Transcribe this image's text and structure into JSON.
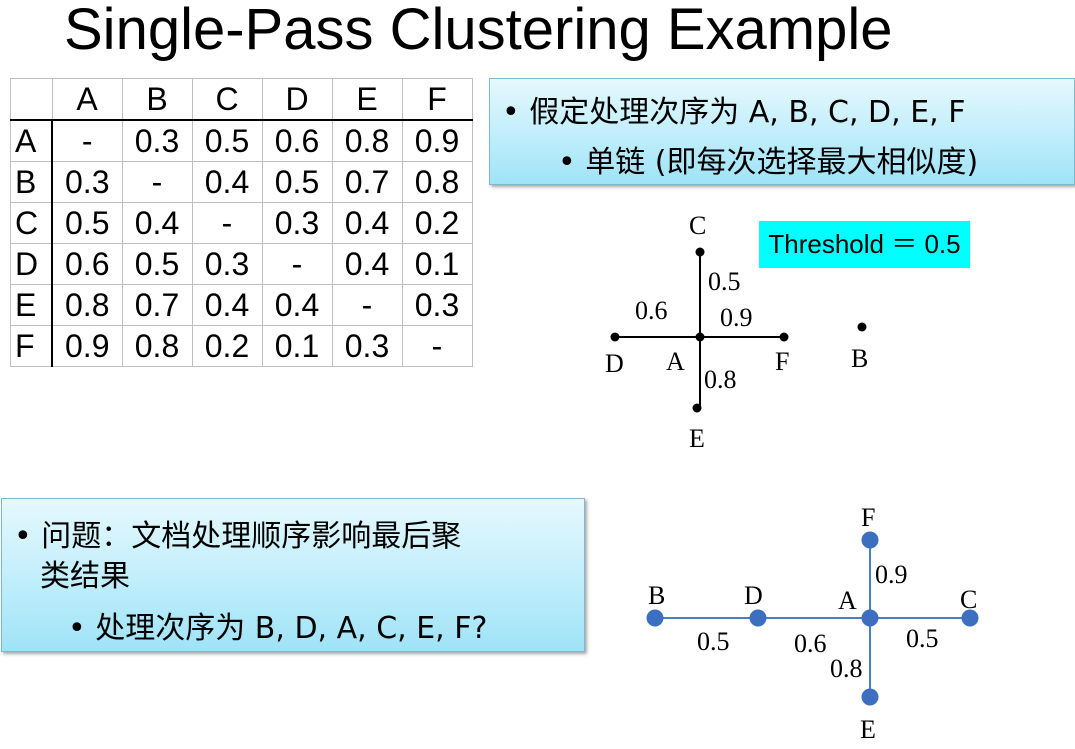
{
  "title": "Single-Pass Clustering Example",
  "matrix": {
    "columns": [
      "A",
      "B",
      "C",
      "D",
      "E",
      "F"
    ],
    "rows": [
      {
        "label": "A",
        "values": [
          "-",
          "0.3",
          "0.5",
          "0.6",
          "0.8",
          "0.9"
        ]
      },
      {
        "label": "B",
        "values": [
          "0.3",
          "-",
          "0.4",
          "0.5",
          "0.7",
          "0.8"
        ]
      },
      {
        "label": "C",
        "values": [
          "0.5",
          "0.4",
          "-",
          "0.3",
          "0.4",
          "0.2"
        ]
      },
      {
        "label": "D",
        "values": [
          "0.6",
          "0.5",
          "0.3",
          "-",
          "0.4",
          "0.1"
        ]
      },
      {
        "label": "E",
        "values": [
          "0.8",
          "0.7",
          "0.4",
          "0.4",
          "-",
          "0.3"
        ]
      },
      {
        "label": "F",
        "values": [
          "0.9",
          "0.8",
          "0.2",
          "0.1",
          "0.3",
          "-"
        ]
      }
    ]
  },
  "box1": {
    "bullet1": "假定处理次序为 A, B, C, D, E, F",
    "bullet2": "单链 (即每次选择最大相似度)"
  },
  "threshold_label": "Threshold ＝ 0.5",
  "graph1": {
    "nodes": {
      "C": "C",
      "D": "D",
      "A": "A",
      "F": "F",
      "E": "E",
      "B": "B"
    },
    "edges": {
      "AC": "0.5",
      "AD": "0.6",
      "AF": "0.9",
      "AE": "0.8"
    },
    "color": "#000000"
  },
  "box2": {
    "bullet1_line1": "问题：文档处理顺序影响最后聚",
    "bullet1_line2": "类结果",
    "bullet2": "处理次序为 B, D, A, C, E, F?"
  },
  "graph2": {
    "nodes": {
      "F": "F",
      "B": "B",
      "D": "D",
      "A": "A",
      "C": "C",
      "E": "E"
    },
    "edges": {
      "BD": "0.5",
      "DA": "0.6",
      "AC": "0.5",
      "AF": "0.9",
      "AE": "0.8"
    },
    "color": "#3c6fbf"
  }
}
